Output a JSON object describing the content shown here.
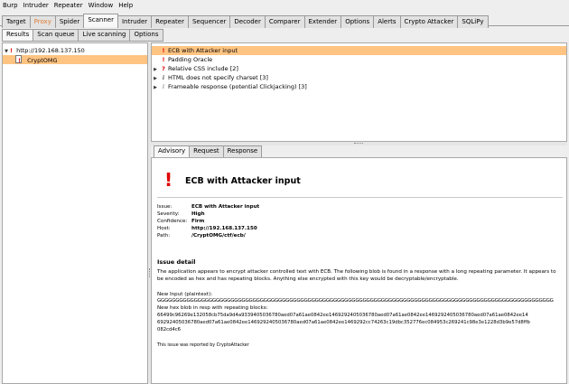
{
  "menubar": {
    "items": [
      "Burp",
      "Intruder",
      "Repeater",
      "Window",
      "Help"
    ]
  },
  "main_tabs": [
    {
      "label": "Target",
      "state": "normal"
    },
    {
      "label": "Proxy",
      "state": "dim"
    },
    {
      "label": "Spider",
      "state": "normal"
    },
    {
      "label": "Scanner",
      "state": "active"
    },
    {
      "label": "Intruder",
      "state": "normal"
    },
    {
      "label": "Repeater",
      "state": "normal"
    },
    {
      "label": "Sequencer",
      "state": "normal"
    },
    {
      "label": "Decoder",
      "state": "normal"
    },
    {
      "label": "Comparer",
      "state": "normal"
    },
    {
      "label": "Extender",
      "state": "normal"
    },
    {
      "label": "Options",
      "state": "normal"
    },
    {
      "label": "Alerts",
      "state": "normal"
    },
    {
      "label": "Crypto Attacker",
      "state": "normal"
    },
    {
      "label": "SQLiPy",
      "state": "normal"
    }
  ],
  "sub_tabs": [
    {
      "label": "Results",
      "state": "active"
    },
    {
      "label": "Scan queue",
      "state": "normal"
    },
    {
      "label": "Live scanning",
      "state": "normal"
    },
    {
      "label": "Options",
      "state": "normal"
    }
  ],
  "tree": {
    "host": "http://192.168.137.150",
    "child": "CryptOMG"
  },
  "issues": [
    {
      "label": "ECB with Attacker input",
      "severity": "high",
      "glyph": "!",
      "expandable": false
    },
    {
      "label": "Padding Oracle",
      "severity": "high",
      "glyph": "!",
      "expandable": false
    },
    {
      "label": "Relative CSS include [2]",
      "severity": "q",
      "glyph": "?",
      "expandable": true
    },
    {
      "label": "HTML does not specify charset [3]",
      "severity": "info",
      "glyph": "i",
      "expandable": true
    },
    {
      "label": "Frameable response (potential Clickjacking) [3]",
      "severity": "light",
      "glyph": "i",
      "expandable": true
    }
  ],
  "detail_tabs": [
    {
      "label": "Advisory",
      "state": "active"
    },
    {
      "label": "Request",
      "state": "normal"
    },
    {
      "label": "Response",
      "state": "normal"
    }
  ],
  "advisory": {
    "icon_glyph": "!",
    "title": "ECB with Attacker input",
    "fields": [
      {
        "key": "Issue:",
        "value": "ECB with Attacker input"
      },
      {
        "key": "Severity:",
        "value": "High"
      },
      {
        "key": "Confidence:",
        "value": "Firm"
      },
      {
        "key": "Host:",
        "value": "http://192.168.137.150"
      },
      {
        "key": "Path:",
        "value": "/CryptOMG/ctf/ecb/"
      }
    ],
    "detail_heading": "Issue detail",
    "detail_line1": "The application appears to encrypt attacker controlled text with ECB. The following blob is found in a response with a long repeating parameter. It appears to",
    "detail_line2": "be encoded as hex and has repeating blocks. Anything else encrypted with this key would be decryptable/encryptable.",
    "input_label": "New Input (plaintext):",
    "input_value": "GGGGGGGGGGGGGGGGGGGGGGGGGGGGGGGGGGGGGGGGGGGGGGGGGGGGGGGGGGGGGGGGGGGGGGGGGGGGGGGGGGGGGGGGGGGGGGGGGGGGGGGGGGGG",
    "blob_label": "New hex blob in resp with repeating blocks:",
    "blob_line1": "66499c96269e132058cb75da9d4a9339405036780aed07a61ae0842ee1469292405036780aed07a61ae0842ee1469292405036780aed07a61ae0842ee14",
    "blob_line2": "69292405036780aed07a61ae0842ee1469292405036780aed07a61ae0842ee1469292cc74263c19dbc352776ec084953c269241c98e3e1228d3b9e57d8ffb",
    "blob_line3": "082cd4c6",
    "footnote": "This issue was reported by CryptoAttacker"
  },
  "colors": {
    "selection": "#ffc482",
    "high": "#e00000",
    "dim_tab": "#e07b35"
  }
}
